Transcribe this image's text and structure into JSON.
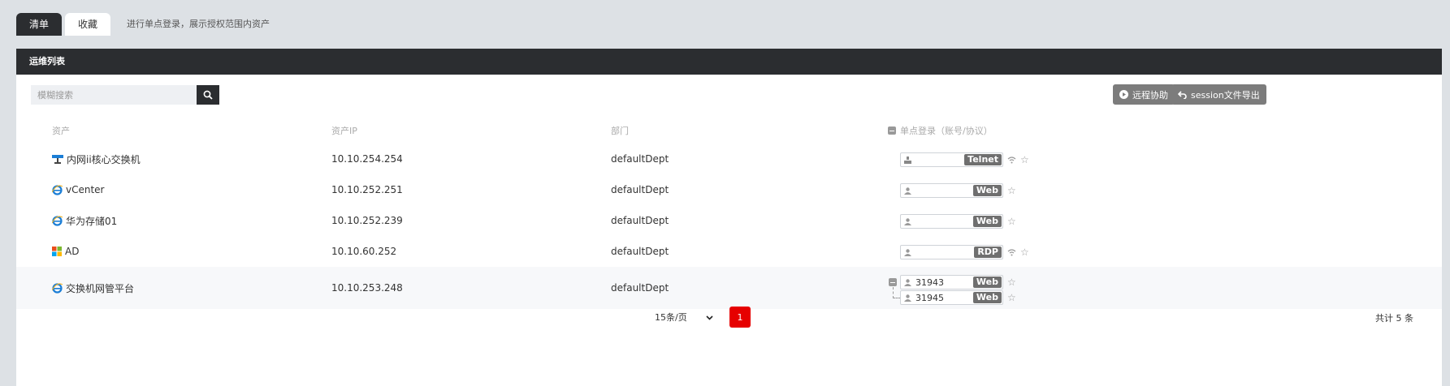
{
  "tabs": {
    "list": "清单",
    "favorites": "收藏",
    "hint": "进行单点登录，展示授权范围内资产"
  },
  "panel": {
    "title": "运维列表"
  },
  "search": {
    "placeholder": "模糊搜索"
  },
  "toolbar": {
    "remote_assist": "远程协助",
    "session_export": "session文件导出"
  },
  "columns": {
    "asset": "资产",
    "ip": "资产IP",
    "dept": "部门",
    "sso": "单点登录（账号/协议）"
  },
  "rows": [
    {
      "name": "内网ii核心交换机",
      "ip": "10.10.254.254",
      "dept": "defaultDept",
      "icon": "network-switch-icon",
      "accounts": [
        {
          "user": "",
          "protocol": "Telnet"
        }
      ]
    },
    {
      "name": "vCenter",
      "ip": "10.10.252.251",
      "dept": "defaultDept",
      "icon": "ie-browser-icon",
      "accounts": [
        {
          "user": "",
          "protocol": "Web"
        }
      ]
    },
    {
      "name": "华为存储01",
      "ip": "10.10.252.239",
      "dept": "defaultDept",
      "icon": "ie-browser-icon",
      "accounts": [
        {
          "user": "",
          "protocol": "Web"
        }
      ]
    },
    {
      "name": "AD",
      "ip": "10.10.60.252",
      "dept": "defaultDept",
      "icon": "windows-icon",
      "accounts": [
        {
          "user": "",
          "protocol": "RDP"
        }
      ]
    },
    {
      "name": "交换机网管平台",
      "ip": "10.10.253.248",
      "dept": "defaultDept",
      "icon": "ie-browser-icon",
      "accounts": [
        {
          "user": "31943",
          "protocol": "Web"
        },
        {
          "user": "31945",
          "protocol": "Web"
        }
      ]
    }
  ],
  "pagination": {
    "page_size": "15条/页",
    "current_page": "1",
    "total": "共计 5 条"
  },
  "colors": {
    "dark": "#2b2d30",
    "accent_red": "#e60000",
    "badge_gray": "#6f6f6f",
    "ie_blue": "#1b7ed6"
  }
}
